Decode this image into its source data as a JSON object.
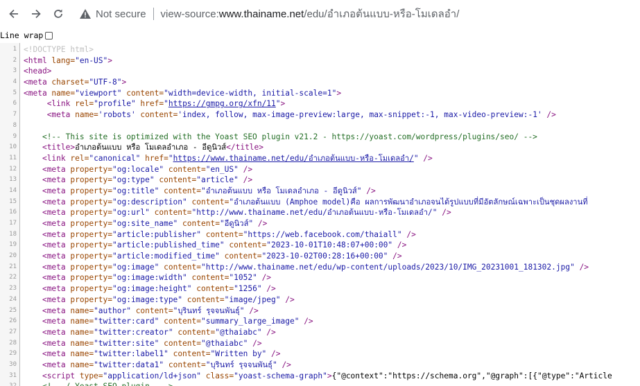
{
  "toolbar": {
    "not_secure": "Not secure",
    "url_scheme": "view-source:",
    "url_host": "www.thainame.net",
    "url_path": "/edu/อำเภอต้นแบบ-หรือ-โมเดลอำ/"
  },
  "line_wrap_label": "Line wrap",
  "lines": [
    {
      "n": "1",
      "tokens": [
        {
          "t": "<!DOCTYPE html>",
          "c": "doctype"
        }
      ]
    },
    {
      "n": "2",
      "tokens": [
        {
          "t": "<html ",
          "c": "tag"
        },
        {
          "t": "lang=",
          "c": "attr"
        },
        {
          "t": "\"en-US\"",
          "c": "val"
        },
        {
          "t": ">",
          "c": "tag"
        }
      ]
    },
    {
      "n": "3",
      "tokens": [
        {
          "t": "<head>",
          "c": "tag"
        }
      ]
    },
    {
      "n": "4",
      "tokens": [
        {
          "t": "<meta ",
          "c": "tag"
        },
        {
          "t": "charset=",
          "c": "attr"
        },
        {
          "t": "\"UTF-8\"",
          "c": "val"
        },
        {
          "t": ">",
          "c": "tag"
        }
      ]
    },
    {
      "n": "5",
      "tokens": [
        {
          "t": "<meta ",
          "c": "tag"
        },
        {
          "t": "name=",
          "c": "attr"
        },
        {
          "t": "\"viewport\" ",
          "c": "val"
        },
        {
          "t": "content=",
          "c": "attr"
        },
        {
          "t": "\"width=device-width, initial-scale=1\"",
          "c": "val"
        },
        {
          "t": ">",
          "c": "tag"
        }
      ]
    },
    {
      "n": "6",
      "tokens": [
        {
          "t": "     ",
          "c": "text"
        },
        {
          "t": "<link ",
          "c": "tag"
        },
        {
          "t": "rel=",
          "c": "attr"
        },
        {
          "t": "\"profile\" ",
          "c": "val"
        },
        {
          "t": "href=",
          "c": "attr"
        },
        {
          "t": "\"",
          "c": "val"
        },
        {
          "t": "https://gmpg.org/xfn/11",
          "c": "link"
        },
        {
          "t": "\"",
          "c": "val"
        },
        {
          "t": ">",
          "c": "tag"
        }
      ]
    },
    {
      "n": "7",
      "tokens": [
        {
          "t": "     ",
          "c": "text"
        },
        {
          "t": "<meta ",
          "c": "tag"
        },
        {
          "t": "name=",
          "c": "attr"
        },
        {
          "t": "'robots' ",
          "c": "val"
        },
        {
          "t": "content=",
          "c": "attr"
        },
        {
          "t": "'index, follow, max-image-preview:large, max-snippet:-1, max-video-preview:-1' ",
          "c": "val"
        },
        {
          "t": "/>",
          "c": "tag"
        }
      ]
    },
    {
      "n": "8",
      "tokens": []
    },
    {
      "n": "9",
      "tokens": [
        {
          "t": "    ",
          "c": "text"
        },
        {
          "t": "<!-- This site is optimized with the Yoast SEO plugin v21.2 - https://yoast.com/wordpress/plugins/seo/ -->",
          "c": "comment"
        }
      ]
    },
    {
      "n": "10",
      "tokens": [
        {
          "t": "    ",
          "c": "text"
        },
        {
          "t": "<title>",
          "c": "tag"
        },
        {
          "t": "อำเภอต้นแบบ หรือ โมเดลอำเภอ - อีดูนิวส์",
          "c": "text"
        },
        {
          "t": "</title>",
          "c": "tag"
        }
      ]
    },
    {
      "n": "11",
      "tokens": [
        {
          "t": "    ",
          "c": "text"
        },
        {
          "t": "<link ",
          "c": "tag"
        },
        {
          "t": "rel=",
          "c": "attr"
        },
        {
          "t": "\"canonical\" ",
          "c": "val"
        },
        {
          "t": "href=",
          "c": "attr"
        },
        {
          "t": "\"",
          "c": "val"
        },
        {
          "t": "https://www.thainame.net/edu/อำเภอต้นแบบ-หรือ-โมเดลอำ/",
          "c": "link"
        },
        {
          "t": "\" ",
          "c": "val"
        },
        {
          "t": "/>",
          "c": "tag"
        }
      ]
    },
    {
      "n": "12",
      "tokens": [
        {
          "t": "    ",
          "c": "text"
        },
        {
          "t": "<meta ",
          "c": "tag"
        },
        {
          "t": "property=",
          "c": "attr"
        },
        {
          "t": "\"og:locale\" ",
          "c": "val"
        },
        {
          "t": "content=",
          "c": "attr"
        },
        {
          "t": "\"en_US\" ",
          "c": "val"
        },
        {
          "t": "/>",
          "c": "tag"
        }
      ]
    },
    {
      "n": "13",
      "tokens": [
        {
          "t": "    ",
          "c": "text"
        },
        {
          "t": "<meta ",
          "c": "tag"
        },
        {
          "t": "property=",
          "c": "attr"
        },
        {
          "t": "\"og:type\" ",
          "c": "val"
        },
        {
          "t": "content=",
          "c": "attr"
        },
        {
          "t": "\"article\" ",
          "c": "val"
        },
        {
          "t": "/>",
          "c": "tag"
        }
      ]
    },
    {
      "n": "14",
      "tokens": [
        {
          "t": "    ",
          "c": "text"
        },
        {
          "t": "<meta ",
          "c": "tag"
        },
        {
          "t": "property=",
          "c": "attr"
        },
        {
          "t": "\"og:title\" ",
          "c": "val"
        },
        {
          "t": "content=",
          "c": "attr"
        },
        {
          "t": "\"อำเภอต้นแบบ หรือ โมเดลอำเภอ - อีดูนิวส์\" ",
          "c": "val"
        },
        {
          "t": "/>",
          "c": "tag"
        }
      ]
    },
    {
      "n": "15",
      "tokens": [
        {
          "t": "    ",
          "c": "text"
        },
        {
          "t": "<meta ",
          "c": "tag"
        },
        {
          "t": "property=",
          "c": "attr"
        },
        {
          "t": "\"og:description\" ",
          "c": "val"
        },
        {
          "t": "content=",
          "c": "attr"
        },
        {
          "t": "\"อำเภอต้นแบบ (Amphoe model)คือ ผลการพัฒนาอำเภอจนได้รูปแบบที่มีอัตลักษณ์เฉพาะเป็นชุดผลงานที่",
          "c": "val"
        }
      ]
    },
    {
      "n": "16",
      "tokens": [
        {
          "t": "    ",
          "c": "text"
        },
        {
          "t": "<meta ",
          "c": "tag"
        },
        {
          "t": "property=",
          "c": "attr"
        },
        {
          "t": "\"og:url\" ",
          "c": "val"
        },
        {
          "t": "content=",
          "c": "attr"
        },
        {
          "t": "\"http://www.thainame.net/edu/อำเภอต้นแบบ-หรือ-โมเดลอำ/\" ",
          "c": "val"
        },
        {
          "t": "/>",
          "c": "tag"
        }
      ]
    },
    {
      "n": "17",
      "tokens": [
        {
          "t": "    ",
          "c": "text"
        },
        {
          "t": "<meta ",
          "c": "tag"
        },
        {
          "t": "property=",
          "c": "attr"
        },
        {
          "t": "\"og:site_name\" ",
          "c": "val"
        },
        {
          "t": "content=",
          "c": "attr"
        },
        {
          "t": "\"อีดูนิวส์\" ",
          "c": "val"
        },
        {
          "t": "/>",
          "c": "tag"
        }
      ]
    },
    {
      "n": "18",
      "tokens": [
        {
          "t": "    ",
          "c": "text"
        },
        {
          "t": "<meta ",
          "c": "tag"
        },
        {
          "t": "property=",
          "c": "attr"
        },
        {
          "t": "\"article:publisher\" ",
          "c": "val"
        },
        {
          "t": "content=",
          "c": "attr"
        },
        {
          "t": "\"https://web.facebook.com/thaiall\" ",
          "c": "val"
        },
        {
          "t": "/>",
          "c": "tag"
        }
      ]
    },
    {
      "n": "19",
      "tokens": [
        {
          "t": "    ",
          "c": "text"
        },
        {
          "t": "<meta ",
          "c": "tag"
        },
        {
          "t": "property=",
          "c": "attr"
        },
        {
          "t": "\"article:published_time\" ",
          "c": "val"
        },
        {
          "t": "content=",
          "c": "attr"
        },
        {
          "t": "\"2023-10-01T10:48:07+00:00\" ",
          "c": "val"
        },
        {
          "t": "/>",
          "c": "tag"
        }
      ]
    },
    {
      "n": "20",
      "tokens": [
        {
          "t": "    ",
          "c": "text"
        },
        {
          "t": "<meta ",
          "c": "tag"
        },
        {
          "t": "property=",
          "c": "attr"
        },
        {
          "t": "\"article:modified_time\" ",
          "c": "val"
        },
        {
          "t": "content=",
          "c": "attr"
        },
        {
          "t": "\"2023-10-02T00:28:16+00:00\" ",
          "c": "val"
        },
        {
          "t": "/>",
          "c": "tag"
        }
      ]
    },
    {
      "n": "21",
      "tokens": [
        {
          "t": "    ",
          "c": "text"
        },
        {
          "t": "<meta ",
          "c": "tag"
        },
        {
          "t": "property=",
          "c": "attr"
        },
        {
          "t": "\"og:image\" ",
          "c": "val"
        },
        {
          "t": "content=",
          "c": "attr"
        },
        {
          "t": "\"http://www.thainame.net/edu/wp-content/uploads/2023/10/IMG_20231001_181302.jpg\" ",
          "c": "val"
        },
        {
          "t": "/>",
          "c": "tag"
        }
      ]
    },
    {
      "n": "22",
      "tokens": [
        {
          "t": "    ",
          "c": "text"
        },
        {
          "t": "<meta ",
          "c": "tag"
        },
        {
          "t": "property=",
          "c": "attr"
        },
        {
          "t": "\"og:image:width\" ",
          "c": "val"
        },
        {
          "t": "content=",
          "c": "attr"
        },
        {
          "t": "\"1052\" ",
          "c": "val"
        },
        {
          "t": "/>",
          "c": "tag"
        }
      ]
    },
    {
      "n": "23",
      "tokens": [
        {
          "t": "    ",
          "c": "text"
        },
        {
          "t": "<meta ",
          "c": "tag"
        },
        {
          "t": "property=",
          "c": "attr"
        },
        {
          "t": "\"og:image:height\" ",
          "c": "val"
        },
        {
          "t": "content=",
          "c": "attr"
        },
        {
          "t": "\"1256\" ",
          "c": "val"
        },
        {
          "t": "/>",
          "c": "tag"
        }
      ]
    },
    {
      "n": "24",
      "tokens": [
        {
          "t": "    ",
          "c": "text"
        },
        {
          "t": "<meta ",
          "c": "tag"
        },
        {
          "t": "property=",
          "c": "attr"
        },
        {
          "t": "\"og:image:type\" ",
          "c": "val"
        },
        {
          "t": "content=",
          "c": "attr"
        },
        {
          "t": "\"image/jpeg\" ",
          "c": "val"
        },
        {
          "t": "/>",
          "c": "tag"
        }
      ]
    },
    {
      "n": "25",
      "tokens": [
        {
          "t": "    ",
          "c": "text"
        },
        {
          "t": "<meta ",
          "c": "tag"
        },
        {
          "t": "name=",
          "c": "attr"
        },
        {
          "t": "\"author\" ",
          "c": "val"
        },
        {
          "t": "content=",
          "c": "attr"
        },
        {
          "t": "\"บุรินทร์ รุจจนพันธุ์\" ",
          "c": "val"
        },
        {
          "t": "/>",
          "c": "tag"
        }
      ]
    },
    {
      "n": "26",
      "tokens": [
        {
          "t": "    ",
          "c": "text"
        },
        {
          "t": "<meta ",
          "c": "tag"
        },
        {
          "t": "name=",
          "c": "attr"
        },
        {
          "t": "\"twitter:card\" ",
          "c": "val"
        },
        {
          "t": "content=",
          "c": "attr"
        },
        {
          "t": "\"summary_large_image\" ",
          "c": "val"
        },
        {
          "t": "/>",
          "c": "tag"
        }
      ]
    },
    {
      "n": "27",
      "tokens": [
        {
          "t": "    ",
          "c": "text"
        },
        {
          "t": "<meta ",
          "c": "tag"
        },
        {
          "t": "name=",
          "c": "attr"
        },
        {
          "t": "\"twitter:creator\" ",
          "c": "val"
        },
        {
          "t": "content=",
          "c": "attr"
        },
        {
          "t": "\"@thaiabc\" ",
          "c": "val"
        },
        {
          "t": "/>",
          "c": "tag"
        }
      ]
    },
    {
      "n": "28",
      "tokens": [
        {
          "t": "    ",
          "c": "text"
        },
        {
          "t": "<meta ",
          "c": "tag"
        },
        {
          "t": "name=",
          "c": "attr"
        },
        {
          "t": "\"twitter:site\" ",
          "c": "val"
        },
        {
          "t": "content=",
          "c": "attr"
        },
        {
          "t": "\"@thaiabc\" ",
          "c": "val"
        },
        {
          "t": "/>",
          "c": "tag"
        }
      ]
    },
    {
      "n": "29",
      "tokens": [
        {
          "t": "    ",
          "c": "text"
        },
        {
          "t": "<meta ",
          "c": "tag"
        },
        {
          "t": "name=",
          "c": "attr"
        },
        {
          "t": "\"twitter:label1\" ",
          "c": "val"
        },
        {
          "t": "content=",
          "c": "attr"
        },
        {
          "t": "\"Written by\" ",
          "c": "val"
        },
        {
          "t": "/>",
          "c": "tag"
        }
      ]
    },
    {
      "n": "30",
      "tokens": [
        {
          "t": "    ",
          "c": "text"
        },
        {
          "t": "<meta ",
          "c": "tag"
        },
        {
          "t": "name=",
          "c": "attr"
        },
        {
          "t": "\"twitter:data1\" ",
          "c": "val"
        },
        {
          "t": "content=",
          "c": "attr"
        },
        {
          "t": "\"บุรินทร์ รุจจนพันธุ์\" ",
          "c": "val"
        },
        {
          "t": "/>",
          "c": "tag"
        }
      ]
    },
    {
      "n": "31",
      "tokens": [
        {
          "t": "    ",
          "c": "text"
        },
        {
          "t": "<script ",
          "c": "tag"
        },
        {
          "t": "type=",
          "c": "attr"
        },
        {
          "t": "\"application/ld+json\" ",
          "c": "val"
        },
        {
          "t": "class=",
          "c": "attr"
        },
        {
          "t": "\"yoast-schema-graph\"",
          "c": "val"
        },
        {
          "t": ">",
          "c": "tag"
        },
        {
          "t": "{\"@context\":\"https://schema.org\",\"@graph\":[{\"@type\":\"Article",
          "c": "text"
        }
      ]
    },
    {
      "n": "32",
      "tokens": [
        {
          "t": "    ",
          "c": "text"
        },
        {
          "t": "<!-- / Yoast SEO plugin. -->",
          "c": "comment"
        }
      ]
    }
  ]
}
